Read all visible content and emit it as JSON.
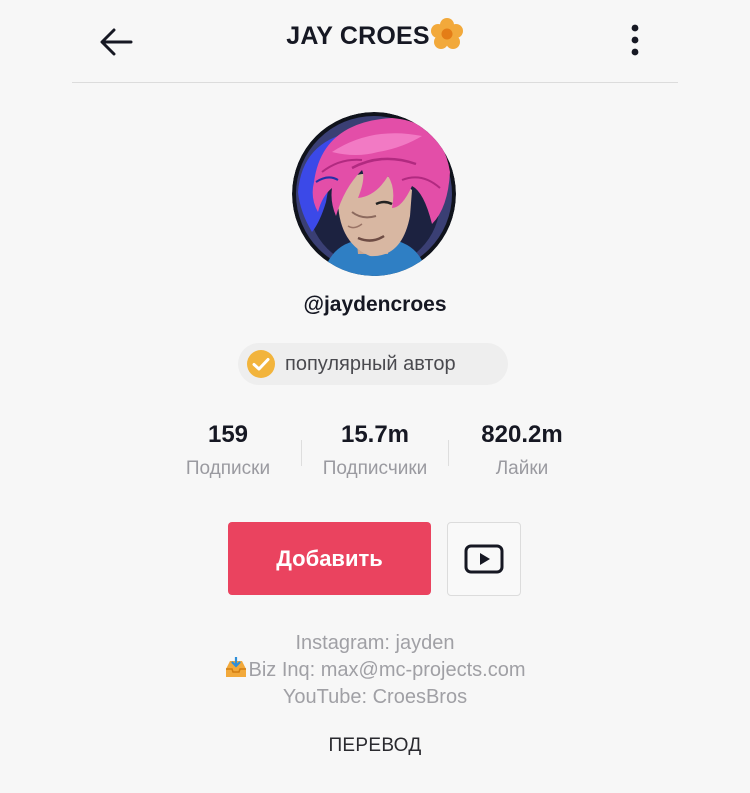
{
  "header": {
    "title": "JAY CROES",
    "back_icon": "arrow-left-icon",
    "title_emoji": "orange-flower-icon",
    "more_icon": "vertical-dots-icon"
  },
  "profile": {
    "avatar": "avatar-illustration-pink-hair",
    "username": "@jaydencroes",
    "badge": {
      "icon": "check-circle-icon",
      "label": "популярный автор",
      "color": "#f2b43c"
    }
  },
  "stats": [
    {
      "value": "159",
      "label": "Подписки"
    },
    {
      "value": "15.7m",
      "label": "Подписчики"
    },
    {
      "value": "820.2m",
      "label": "Лайки"
    }
  ],
  "actions": {
    "add_label": "Добавить",
    "add_color": "#ea435f",
    "youtube_icon": "youtube-play-icon"
  },
  "bio": {
    "line1": "Instagram: jayden",
    "line2_icon": "inbox-tray-icon",
    "line2": "Biz Inq: max@mc-projects.com",
    "line3": "YouTube: CroesBros"
  },
  "translate_label": "ПЕРЕВОД"
}
